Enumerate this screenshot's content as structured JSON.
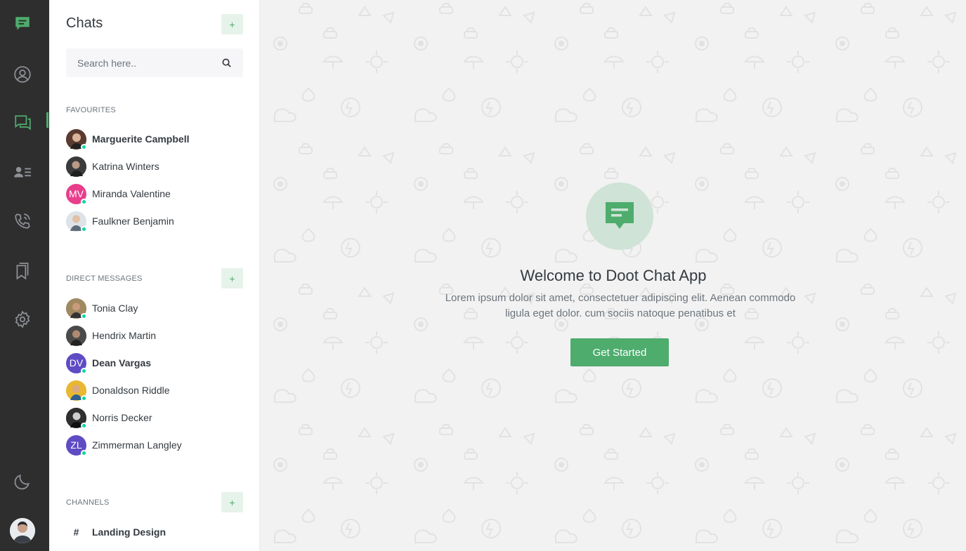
{
  "rail": {
    "icons": [
      "chat-logo-icon",
      "profile-icon",
      "chats-icon",
      "contacts-icon",
      "calls-icon",
      "bookmarks-icon",
      "settings-icon",
      "theme-moon-icon"
    ],
    "accent": "#4eac6d"
  },
  "sidebar": {
    "title": "Chats",
    "add_chat_label": "+",
    "search": {
      "placeholder": "Search here.."
    },
    "favourites": {
      "heading": "FAVOURITES",
      "items": [
        {
          "name": "Marguerite Campbell",
          "bold": true,
          "online": true,
          "initials": ""
        },
        {
          "name": "Katrina Winters",
          "bold": false,
          "online": false,
          "initials": ""
        },
        {
          "name": "Miranda Valentine",
          "bold": false,
          "online": true,
          "initials": "MV"
        },
        {
          "name": "Faulkner Benjamin",
          "bold": false,
          "online": true,
          "initials": ""
        }
      ]
    },
    "direct_messages": {
      "heading": "DIRECT MESSAGES",
      "add_label": "+",
      "items": [
        {
          "name": "Tonia Clay",
          "bold": false,
          "online": true,
          "initials": ""
        },
        {
          "name": "Hendrix Martin",
          "bold": false,
          "online": false,
          "initials": ""
        },
        {
          "name": "Dean Vargas",
          "bold": true,
          "online": true,
          "initials": "DV"
        },
        {
          "name": "Donaldson Riddle",
          "bold": false,
          "online": true,
          "initials": ""
        },
        {
          "name": "Norris Decker",
          "bold": false,
          "online": true,
          "initials": ""
        },
        {
          "name": "Zimmerman Langley",
          "bold": false,
          "online": true,
          "initials": "ZL"
        }
      ]
    },
    "channels": {
      "heading": "CHANNELS",
      "add_label": "+",
      "items": [
        {
          "prefix": "#",
          "name": "Landing Design",
          "bold": true
        }
      ]
    }
  },
  "main": {
    "title": "Welcome to Doot Chat App",
    "text": "Lorem ipsum dolor sit amet, consectetuer adipiscing elit. Aenean commodo ligula eget dolor. cum sociis natoque penatibus et",
    "button": "Get Started"
  }
}
